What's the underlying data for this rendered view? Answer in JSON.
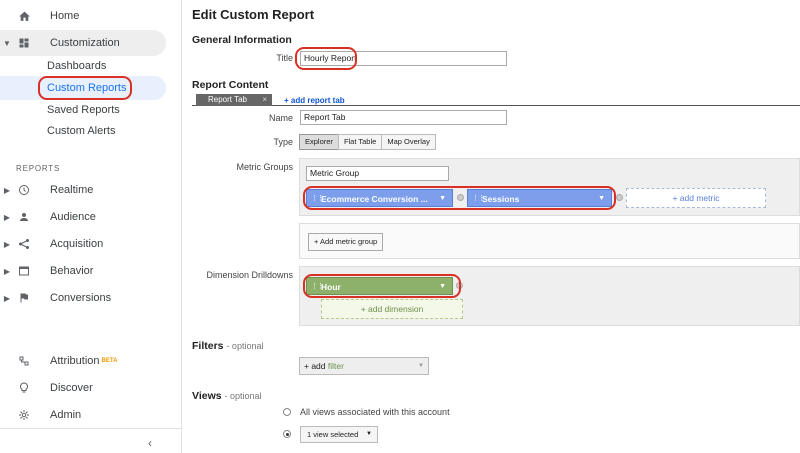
{
  "sidebar": {
    "home": {
      "label": "Home",
      "icon": "home-icon"
    },
    "customization": {
      "label": "Customization",
      "icon": "dashboard-grid-icon"
    },
    "sub_items": [
      {
        "label": "Dashboards"
      },
      {
        "label": "Custom Reports"
      },
      {
        "label": "Saved Reports"
      },
      {
        "label": "Custom Alerts"
      }
    ],
    "section_label": "REPORTS",
    "reports": [
      {
        "label": "Realtime",
        "icon": "clock-icon"
      },
      {
        "label": "Audience",
        "icon": "person-icon"
      },
      {
        "label": "Acquisition",
        "icon": "acquisition-icon"
      },
      {
        "label": "Behavior",
        "icon": "behavior-icon"
      },
      {
        "label": "Conversions",
        "icon": "flag-icon"
      }
    ],
    "bottom": [
      {
        "label": "Attribution",
        "badge": "BETA",
        "icon": "attribution-icon"
      },
      {
        "label": "Discover",
        "icon": "lightbulb-icon"
      },
      {
        "label": "Admin",
        "icon": "gear-icon"
      }
    ],
    "collapse_glyph": "‹"
  },
  "main": {
    "title": "Edit Custom Report",
    "general_heading": "General Information",
    "title_label": "Title",
    "title_value": "Hourly Report",
    "content_heading": "Report Content",
    "tab_label": "Report Tab",
    "tab_close": "×",
    "add_tab": "+ add report tab",
    "name_label": "Name",
    "name_value": "Report Tab",
    "type_label": "Type",
    "types": [
      "Explorer",
      "Flat Table",
      "Map Overlay"
    ],
    "metric_groups_label": "Metric Groups",
    "metric_group_name": "Metric Group",
    "metrics": [
      "Ecommerce Conversion ...",
      "Sessions"
    ],
    "add_metric": "+ add metric",
    "add_metric_group": "+ Add metric group",
    "dimension_label": "Dimension Drilldowns",
    "dimension": "Hour",
    "add_dimension": "+ add dimension",
    "filters_heading": "Filters",
    "optional": "- optional",
    "add_filter_prefix": "+ add",
    "add_filter_kw": "filter",
    "views_heading": "Views",
    "views_all": "All views associated with this account",
    "views_selected": "1 view selected"
  }
}
